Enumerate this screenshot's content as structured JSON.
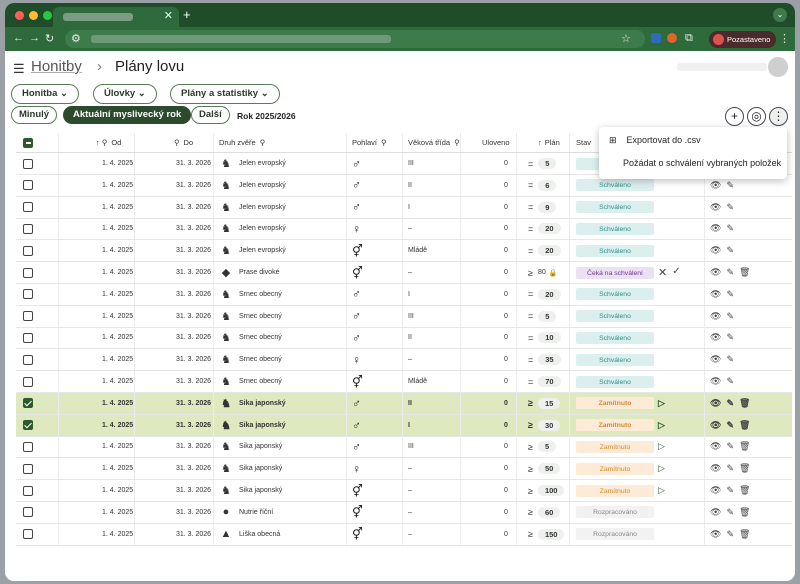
{
  "browser": {
    "status_label": "Pozastaveno"
  },
  "breadcrumb": {
    "parent": "Honitby",
    "separator": "›",
    "current": "Plány lovu"
  },
  "nav_buttons": {
    "honitba": "Honitba",
    "ulovky": "Úlovky",
    "plany": "Plány a statistiky"
  },
  "year_buttons": {
    "prev": "Minulý",
    "current": "Aktuální myslivecký rok",
    "next": "Další",
    "year_label": "Rok 2025/2026"
  },
  "menu": {
    "export": "Exportovat do .csv",
    "request": "Požádat o schválení vybraných položek"
  },
  "columns": {
    "od": "Od",
    "do": "Do",
    "druh": "Druh zvěře",
    "pohlavi": "Pohlaví",
    "trida": "Věková třída",
    "uloveno": "Uloveno",
    "plan": "Plán",
    "stav": "Stav"
  },
  "status_colors": {
    "Schváleno": "#dcefef",
    "Čeká na schválení": "#ece0f5",
    "Zamítnuto": "#fdebd7",
    "Rozpracováno": "#f2f2f2"
  },
  "rows": [
    {
      "od": "1. 4. 2025",
      "do": "31. 3. 2026",
      "druh": "Jelen evropský",
      "animal": "deer",
      "sex": "♂",
      "trida": "III",
      "uloveno": "0",
      "cmp": "=",
      "plan": "5",
      "stav": "Schváleno",
      "sel": false
    },
    {
      "od": "1. 4. 2025",
      "do": "31. 3. 2026",
      "druh": "Jelen evropský",
      "animal": "deer",
      "sex": "♂",
      "trida": "II",
      "uloveno": "0",
      "cmp": "=",
      "plan": "6",
      "stav": "Schváleno",
      "sel": false
    },
    {
      "od": "1. 4. 2025",
      "do": "31. 3. 2026",
      "druh": "Jelen evropský",
      "animal": "deer",
      "sex": "♂",
      "trida": "I",
      "uloveno": "0",
      "cmp": "=",
      "plan": "9",
      "stav": "Schváleno",
      "sel": false
    },
    {
      "od": "1. 4. 2025",
      "do": "31. 3. 2026",
      "druh": "Jelen evropský",
      "animal": "deer",
      "sex": "♀",
      "trida": "–",
      "uloveno": "0",
      "cmp": "=",
      "plan": "20",
      "stav": "Schváleno",
      "sel": false
    },
    {
      "od": "1. 4. 2025",
      "do": "31. 3. 2026",
      "druh": "Jelen evropský",
      "animal": "deer",
      "sex": "⚥",
      "trida": "Mládě",
      "uloveno": "0",
      "cmp": "=",
      "plan": "20",
      "stav": "Schváleno",
      "sel": false
    },
    {
      "od": "1. 4. 2025",
      "do": "31. 3. 2026",
      "druh": "Prase divoké",
      "animal": "boar",
      "sex": "⚥",
      "trida": "–",
      "uloveno": "0",
      "cmp": "≥",
      "plan": "80",
      "stav": "Čeká na schválení",
      "sel": false,
      "locked": true
    },
    {
      "od": "1. 4. 2025",
      "do": "31. 3. 2026",
      "druh": "Srnec obecný",
      "animal": "deer",
      "sex": "♂",
      "trida": "I",
      "uloveno": "0",
      "cmp": "=",
      "plan": "20",
      "stav": "Schváleno",
      "sel": false
    },
    {
      "od": "1. 4. 2025",
      "do": "31. 3. 2026",
      "druh": "Srnec obecný",
      "animal": "deer",
      "sex": "♂",
      "trida": "III",
      "uloveno": "0",
      "cmp": "=",
      "plan": "5",
      "stav": "Schváleno",
      "sel": false
    },
    {
      "od": "1. 4. 2025",
      "do": "31. 3. 2026",
      "druh": "Srnec obecný",
      "animal": "deer",
      "sex": "♂",
      "trida": "II",
      "uloveno": "0",
      "cmp": "=",
      "plan": "10",
      "stav": "Schváleno",
      "sel": false
    },
    {
      "od": "1. 4. 2025",
      "do": "31. 3. 2026",
      "druh": "Srnec obecný",
      "animal": "deer",
      "sex": "♀",
      "trida": "–",
      "uloveno": "0",
      "cmp": "=",
      "plan": "35",
      "stav": "Schváleno",
      "sel": false
    },
    {
      "od": "1. 4. 2025",
      "do": "31. 3. 2026",
      "druh": "Srnec obecný",
      "animal": "deer",
      "sex": "⚥",
      "trida": "Mládě",
      "uloveno": "0",
      "cmp": "=",
      "plan": "70",
      "stav": "Schváleno",
      "sel": false
    },
    {
      "od": "1. 4. 2025",
      "do": "31. 3. 2026",
      "druh": "Sika japonský",
      "animal": "deer",
      "sex": "♂",
      "trida": "II",
      "uloveno": "0",
      "cmp": "≥",
      "plan": "15",
      "stav": "Zamítnuto",
      "sel": true
    },
    {
      "od": "1. 4. 2025",
      "do": "31. 3. 2026",
      "druh": "Sika japonský",
      "animal": "deer",
      "sex": "♂",
      "trida": "I",
      "uloveno": "0",
      "cmp": "≥",
      "plan": "30",
      "stav": "Zamítnuto",
      "sel": true
    },
    {
      "od": "1. 4. 2025",
      "do": "31. 3. 2026",
      "druh": "Sika japonský",
      "animal": "deer",
      "sex": "♂",
      "trida": "III",
      "uloveno": "0",
      "cmp": "≥",
      "plan": "5",
      "stav": "Zamítnuto",
      "sel": false
    },
    {
      "od": "1. 4. 2025",
      "do": "31. 3. 2026",
      "druh": "Sika japonský",
      "animal": "deer",
      "sex": "♀",
      "trida": "–",
      "uloveno": "0",
      "cmp": "≥",
      "plan": "50",
      "stav": "Zamítnuto",
      "sel": false
    },
    {
      "od": "1. 4. 2025",
      "do": "31. 3. 2026",
      "druh": "Sika japonský",
      "animal": "deer",
      "sex": "⚥",
      "trida": "–",
      "uloveno": "0",
      "cmp": "≥",
      "plan": "100",
      "stav": "Zamítnuto",
      "sel": false
    },
    {
      "od": "1. 4. 2025",
      "do": "31. 3. 2026",
      "druh": "Nutrie říční",
      "animal": "nutria",
      "sex": "⚥",
      "trida": "–",
      "uloveno": "0",
      "cmp": "≥",
      "plan": "60",
      "stav": "Rozpracováno",
      "sel": false
    },
    {
      "od": "1. 4. 2025",
      "do": "31. 3. 2026",
      "druh": "Liška obecná",
      "animal": "fox",
      "sex": "⚥",
      "trida": "–",
      "uloveno": "0",
      "cmp": "≥",
      "plan": "150",
      "stav": "Rozpracováno",
      "sel": false
    }
  ]
}
